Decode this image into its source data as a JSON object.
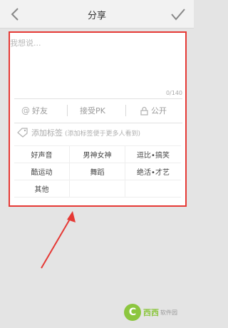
{
  "header": {
    "title": "分享",
    "back_icon": "chevron-left-icon",
    "confirm_icon": "checkmark-icon"
  },
  "post": {
    "placeholder": "我想说...",
    "value": "",
    "counter": "0/140"
  },
  "share_options": [
    {
      "icon": "at-sign-icon",
      "icon_glyph": "@",
      "label": "好友"
    },
    {
      "label": "接受PK"
    },
    {
      "icon": "lock-icon",
      "label": "公开"
    }
  ],
  "tags": {
    "label": "添加标签",
    "hint": "(添加标签便于更多人看到)",
    "items": [
      "好声音",
      "男神女神",
      "逗比•搞笑",
      "酷运动",
      "舞蹈",
      "绝活•才艺",
      "其他"
    ]
  },
  "watermark": {
    "logo_glyph": "C",
    "name": "西西",
    "domain": "软件园"
  },
  "colors": {
    "highlight_box": "#e53935",
    "annotation_arrow": "#e53935",
    "watermark": "#8cc63f"
  }
}
